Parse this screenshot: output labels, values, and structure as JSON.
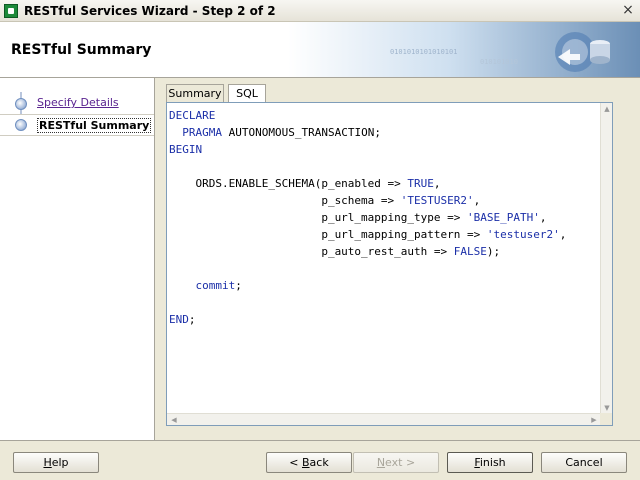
{
  "window": {
    "title": "RESTful Services Wizard - Step 2 of 2",
    "close_glyph": "×"
  },
  "header": {
    "title": "RESTful Summary",
    "decor_bits_1": "0101010101010101",
    "decor_bits_2": "010101010"
  },
  "steps": [
    {
      "label": "Specify Details",
      "state": "completed"
    },
    {
      "label": "RESTful Summary",
      "state": "current"
    }
  ],
  "tabs": [
    {
      "label": "Summary",
      "selected": false
    },
    {
      "label": "SQL",
      "selected": true
    }
  ],
  "sql": {
    "lines": [
      "DECLARE",
      "  PRAGMA AUTONOMOUS_TRANSACTION;",
      "BEGIN",
      "",
      "    ORDS.ENABLE_SCHEMA(p_enabled => TRUE,",
      "                       p_schema => 'TESTUSER2',",
      "                       p_url_mapping_type => 'BASE_PATH',",
      "                       p_url_mapping_pattern => 'testuser2',",
      "                       p_auto_rest_auth => FALSE);",
      "",
      "    commit;",
      "",
      "END;"
    ]
  },
  "buttons": {
    "help": "Help",
    "back": "< Back",
    "next": "Next >",
    "finish": "Finish",
    "cancel": "Cancel"
  },
  "colors": {
    "keyword": "#1b2fa8",
    "link": "#5a2490",
    "editor_border": "#7f9db9"
  }
}
